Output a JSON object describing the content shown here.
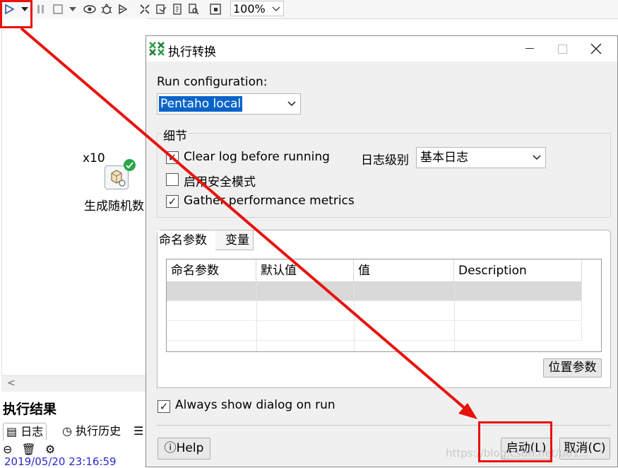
{
  "toolbar": {
    "zoom_value": "100%",
    "icons": [
      "run-icon",
      "run-dropdown-icon",
      "pause-icon",
      "stop-icon",
      "stop-dropdown-icon",
      "preview-icon",
      "debug-icon",
      "replay-icon",
      "verify-icon",
      "impact-icon",
      "sql-icon",
      "explore-db-icon",
      "grid-icon"
    ]
  },
  "canvas": {
    "step_count": "x10",
    "step_label": "生成随机数"
  },
  "results": {
    "title": "执行结果",
    "tabs": [
      "日志",
      "执行历史"
    ],
    "timestamp": "2019/05/20 23:16:59"
  },
  "dialog": {
    "title": "执行转换",
    "run_config_label": "Run configuration:",
    "run_config_value": "Pentaho local",
    "details_label": "细节",
    "clear_log_label": "Clear log before running",
    "clear_log_checked": true,
    "log_level_label": "日志级别",
    "log_level_value": "基本日志",
    "safe_mode_label": "启用安全模式",
    "safe_mode_checked": false,
    "gather_metrics_label": "Gather performance metrics",
    "gather_metrics_checked": true,
    "tabs": [
      "命名参数",
      "变量"
    ],
    "table_headers": [
      "命名参数",
      "默认值",
      "值",
      "Description"
    ],
    "position_params_button": "位置参数",
    "always_show_label": "Always show dialog on run",
    "always_show_checked": true,
    "help_button": "Help",
    "start_button": "启动(L)",
    "cancel_button": "取消(C)"
  },
  "watermark": "https://blog.csdn.net/u01...",
  "annotation_color": "#e8120c"
}
